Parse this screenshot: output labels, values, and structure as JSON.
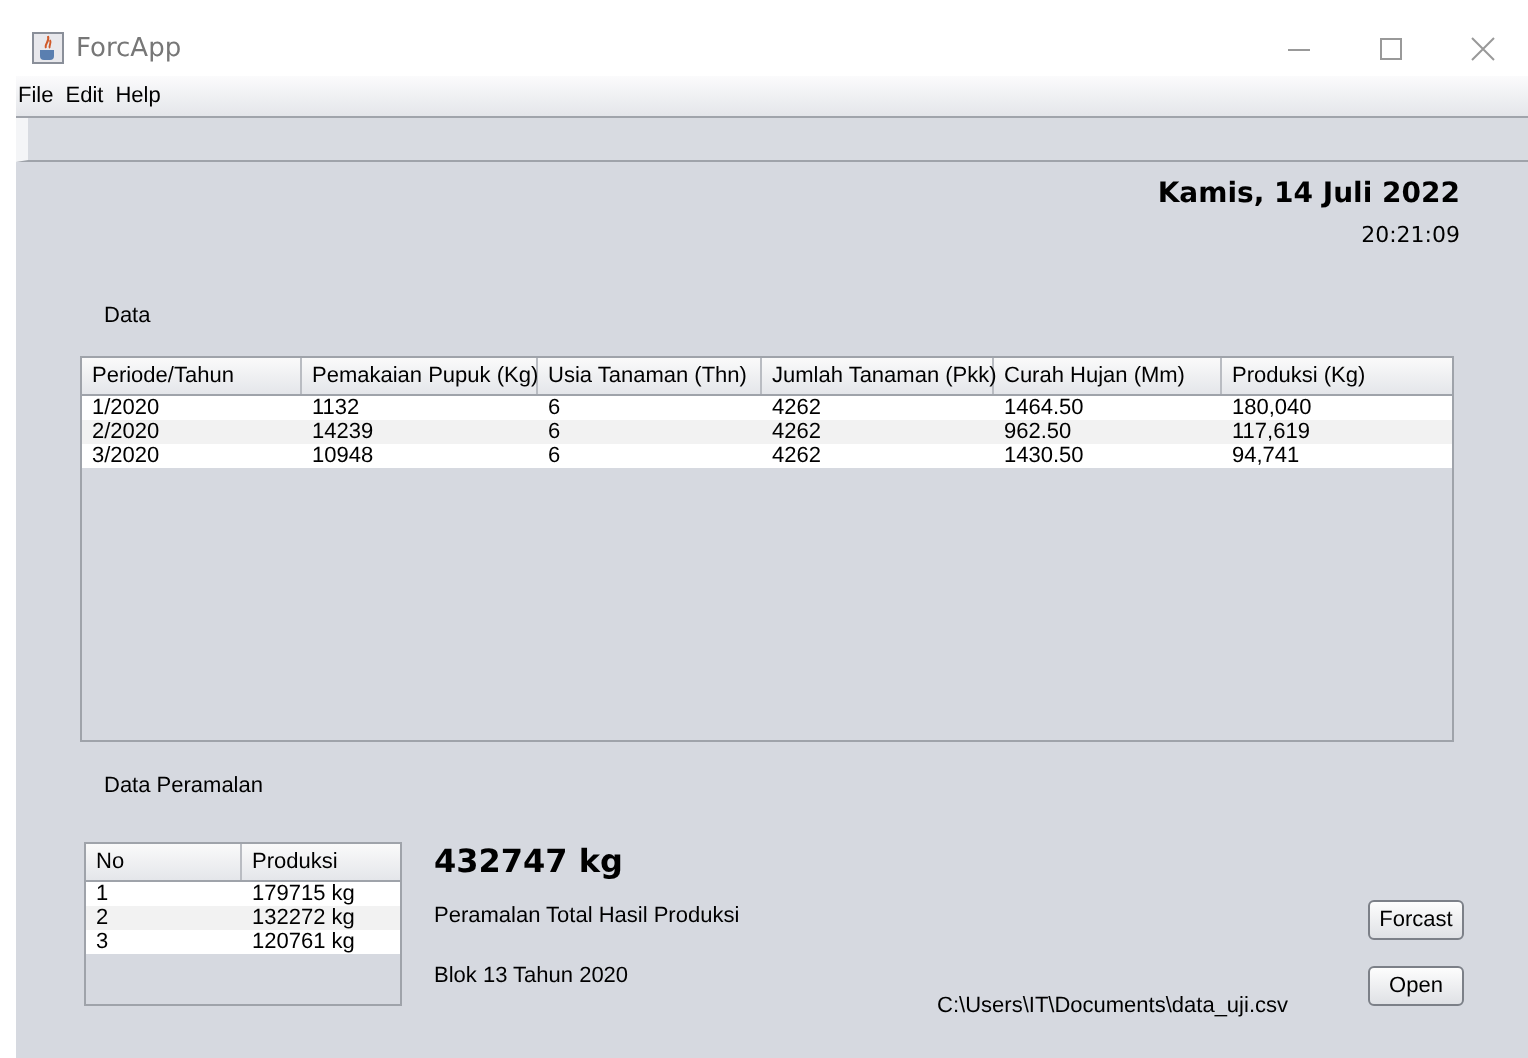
{
  "window": {
    "title": "ForcApp"
  },
  "menu": [
    "File",
    "Edit",
    "Help"
  ],
  "date": "Kamis, 14 Juli 2022",
  "time": "20:21:09",
  "data_label": "Data",
  "table": {
    "columns": [
      "Periode/Tahun",
      "Pemakaian Pupuk (Kg)",
      "Usia Tanaman (Thn)",
      "Jumlah Tanaman (Pkk)",
      "Curah Hujan (Mm)",
      "Produksi (Kg)"
    ],
    "rows": [
      [
        "1/2020",
        "1132",
        "6",
        "4262",
        "1464.50",
        "180,040"
      ],
      [
        "2/2020",
        "14239",
        "6",
        "4262",
        "962.50",
        "117,619"
      ],
      [
        "3/2020",
        "10948",
        "6",
        "4262",
        "1430.50",
        "94,741"
      ]
    ]
  },
  "forecast_label": "Data Peramalan",
  "forecast_table": {
    "columns": [
      "No",
      "Produksi"
    ],
    "rows": [
      [
        "1",
        "179715 kg"
      ],
      [
        "2",
        "132272 kg"
      ],
      [
        "3",
        "120761 kg"
      ]
    ]
  },
  "total": "432747 kg",
  "total_caption": "Peramalan Total Hasil Produksi",
  "block": "Blok 13 Tahun 2020",
  "file_path": "C:\\Users\\IT\\Documents\\data_uji.csv",
  "buttons": [
    "Forcast",
    "Open"
  ]
}
